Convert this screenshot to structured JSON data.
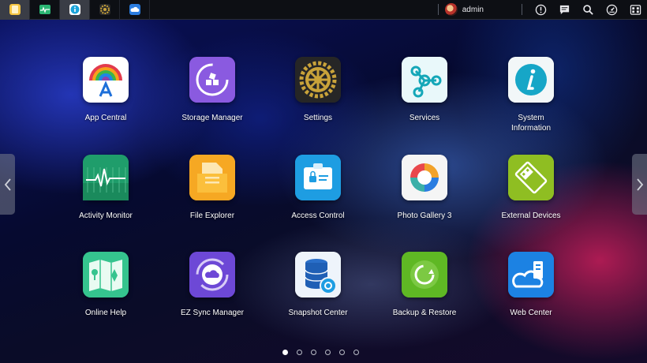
{
  "taskbar": {
    "apps": [
      {
        "name": "notes-icon",
        "color": "#f5c542",
        "active": true
      },
      {
        "name": "activity-icon",
        "color": "#2bb673",
        "active": false
      },
      {
        "name": "info-icon",
        "color": "#1aa3d9",
        "active": true
      },
      {
        "name": "settings-gear-icon",
        "color": "#c9a33a",
        "active": false
      },
      {
        "name": "cloud-icon",
        "color": "#2b7de0",
        "active": false
      }
    ],
    "user": "admin",
    "icons": [
      "alert-icon",
      "message-icon",
      "search-icon",
      "dashboard-icon",
      "more-apps-icon"
    ]
  },
  "apps": [
    {
      "label": "App Central",
      "icon": "app-central-icon"
    },
    {
      "label": "Storage Manager",
      "icon": "storage-manager-icon"
    },
    {
      "label": "Settings",
      "icon": "settings-icon"
    },
    {
      "label": "Services",
      "icon": "services-icon"
    },
    {
      "label": "System Information",
      "icon": "system-information-icon"
    },
    {
      "label": "Activity Monitor",
      "icon": "activity-monitor-icon"
    },
    {
      "label": "File Explorer",
      "icon": "file-explorer-icon"
    },
    {
      "label": "Access Control",
      "icon": "access-control-icon"
    },
    {
      "label": "Photo Gallery 3",
      "icon": "photo-gallery-icon"
    },
    {
      "label": "External Devices",
      "icon": "external-devices-icon"
    },
    {
      "label": "Online Help",
      "icon": "online-help-icon"
    },
    {
      "label": "EZ Sync Manager",
      "icon": "ez-sync-icon"
    },
    {
      "label": "Snapshot Center",
      "icon": "snapshot-center-icon"
    },
    {
      "label": "Backup & Restore",
      "icon": "backup-restore-icon"
    },
    {
      "label": "Web Center",
      "icon": "web-center-icon"
    }
  ],
  "pagination": {
    "pages": 6,
    "current": 1
  }
}
